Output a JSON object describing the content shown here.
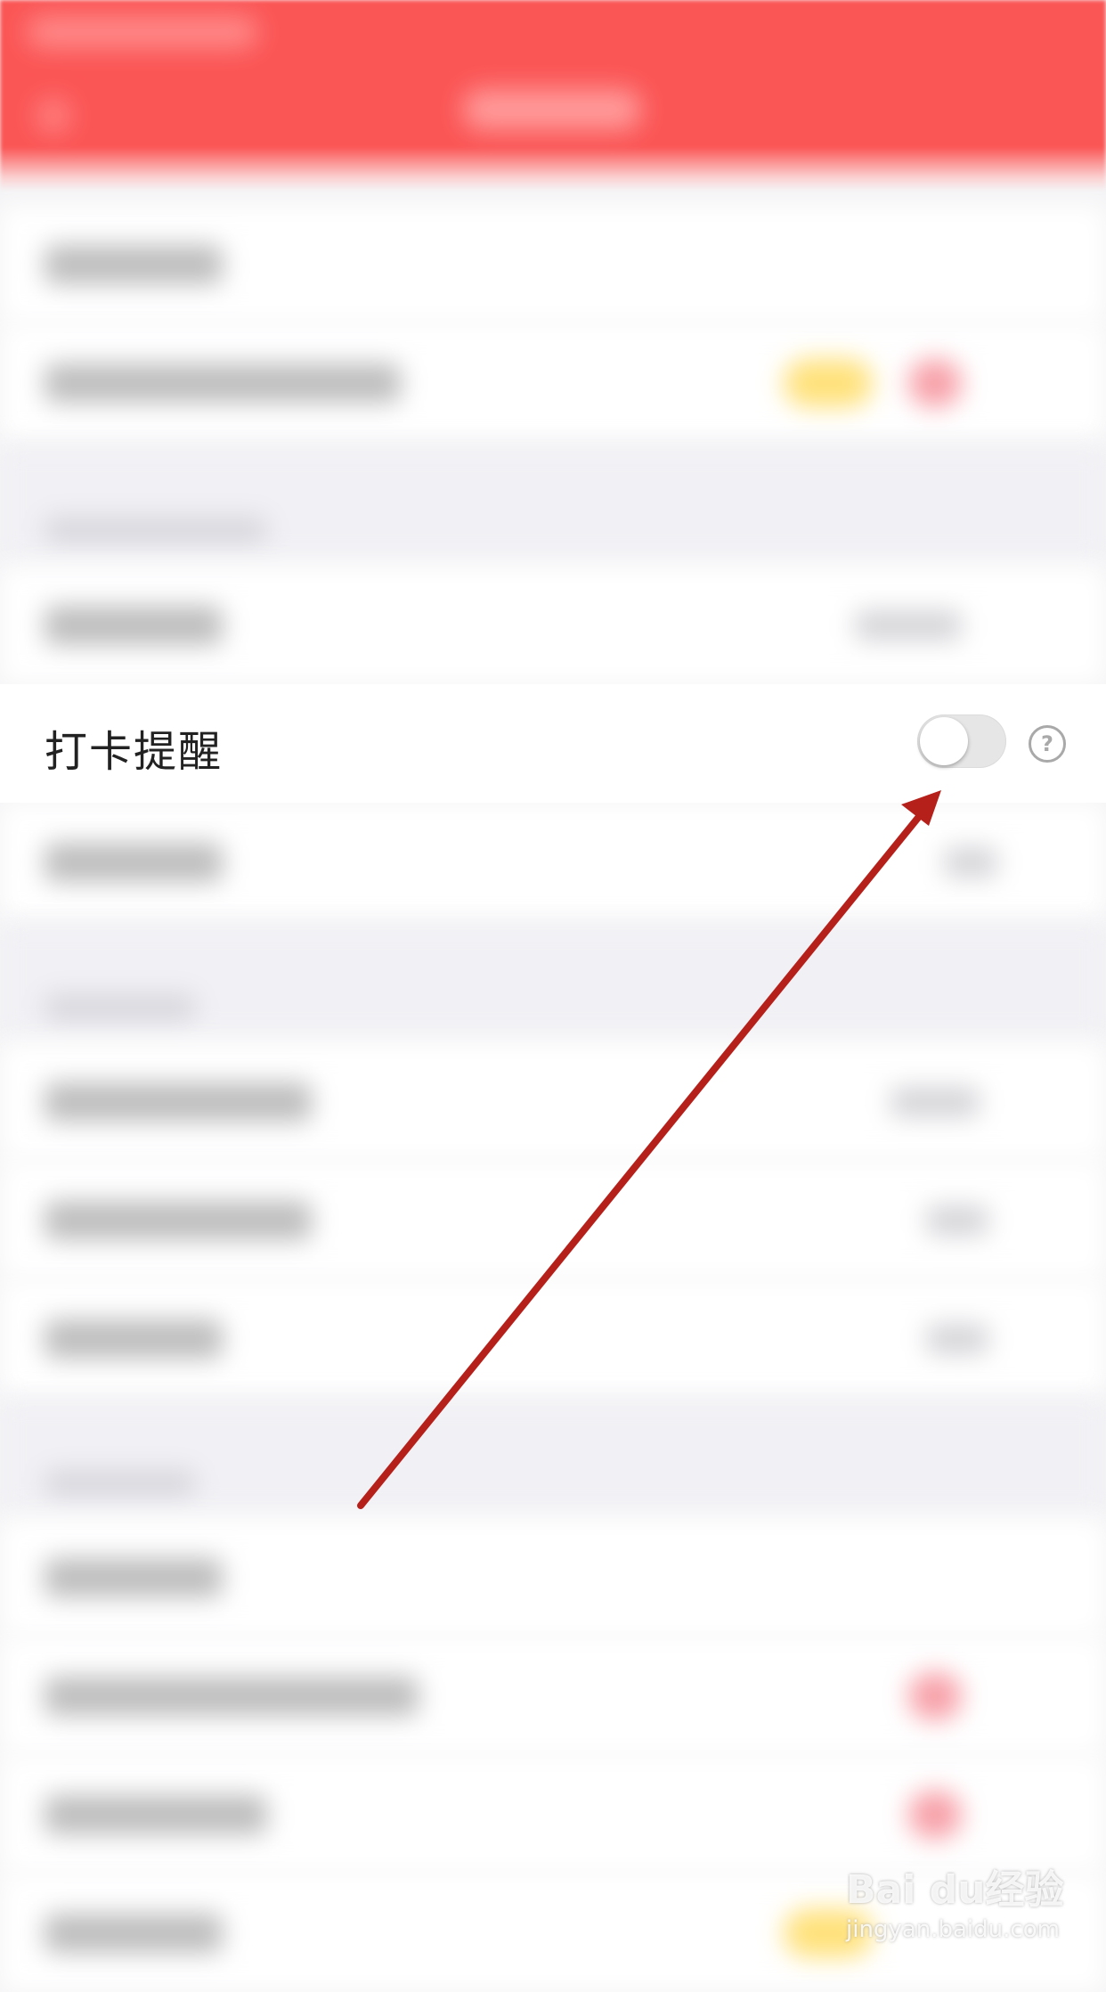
{
  "setting_row": {
    "label": "打卡提醒",
    "toggle_on": false
  },
  "help_icon": {
    "glyph": "?"
  },
  "watermark": {
    "logo_text": "Bai du经验",
    "url": "jingyan.baidu.com"
  },
  "colors": {
    "header": "#fb5656",
    "annotation_arrow": "#b5201a",
    "toggle_off": "#e6e6e6"
  }
}
